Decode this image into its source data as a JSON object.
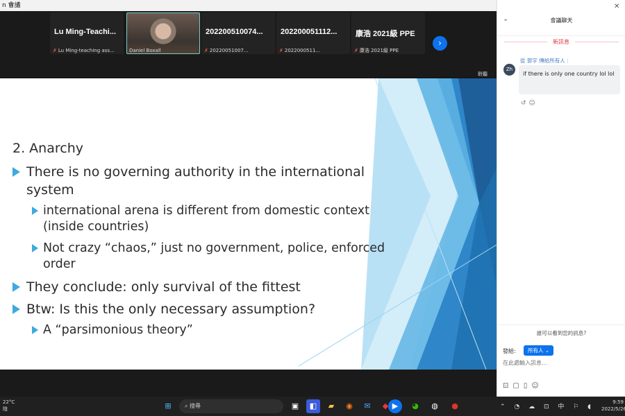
{
  "window": {
    "title": "n 會議"
  },
  "participants": [
    {
      "name": "Lu Ming-Teachi...",
      "sub": "Lu Ming-teaching ass..."
    },
    {
      "name": "",
      "sub": "Daniel Boxall"
    },
    {
      "name": "202200510074...",
      "sub": "20220051007..."
    },
    {
      "name": "202200051112...",
      "sub": "2022000511..."
    },
    {
      "name": "康浩 2021級 PPE",
      "sub": "康浩 2021級 PPE"
    }
  ],
  "strip_label": "聆聽",
  "slide": {
    "heading": "2. Anarchy",
    "bullets": [
      {
        "level": 1,
        "text": "There is no governing authority in the international system"
      },
      {
        "level": 2,
        "text": "international arena is different from domestic context (inside countries)"
      },
      {
        "level": 2,
        "text": "Not crazy “chaos,” just no government, police, enforced order"
      },
      {
        "level": 1,
        "text": "They conclude: only survival of the fittest"
      },
      {
        "level": 1,
        "text": "Btw: Is this the only necessary assumption?"
      },
      {
        "level": 2,
        "text": "A “parsimonious theory”"
      }
    ],
    "accent_color": "#3fa9e0"
  },
  "chat": {
    "title": "會議聊天",
    "new_messages": "新訊息",
    "message": {
      "avatar": "Zh",
      "sender": "從 郭宇 傳給所有人 : ",
      "text": "if there is only one country lol lol"
    },
    "who_can_see": "誰可以看到您的訊息?",
    "send_to_label": "發給:",
    "send_to_value": "所有人",
    "input_placeholder": "在此處輸入訊息..."
  },
  "taskbar": {
    "weather_temp": "22°C",
    "weather_desc": "陰",
    "search_label": "搜尋",
    "time": "9:59",
    "date": "2022/5/26"
  }
}
